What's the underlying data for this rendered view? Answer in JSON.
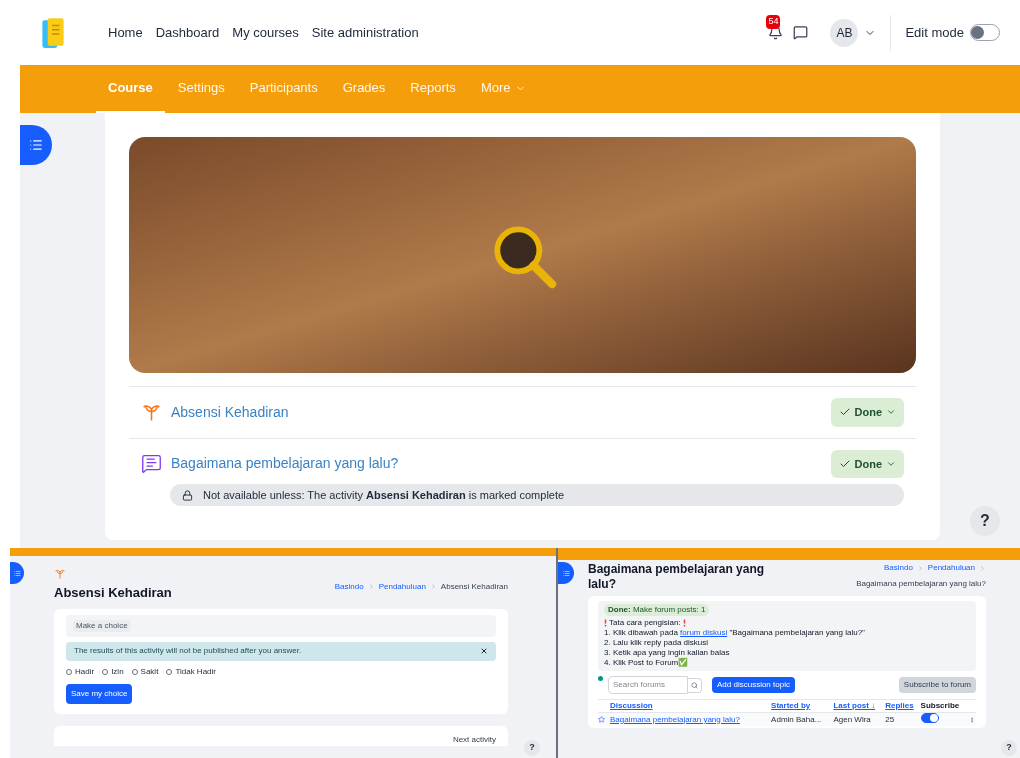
{
  "header": {
    "nav": [
      "Home",
      "Dashboard",
      "My courses",
      "Site administration"
    ],
    "notification_count": "54",
    "avatar": "AB",
    "edit_mode": {
      "label": "Edit mode",
      "on": false
    }
  },
  "tabs": [
    {
      "label": "Course",
      "selected": true
    },
    {
      "label": "Settings",
      "selected": false
    },
    {
      "label": "Participants",
      "selected": false
    },
    {
      "label": "Grades",
      "selected": false
    },
    {
      "label": "Reports",
      "selected": false
    },
    {
      "label": "More",
      "selected": false
    }
  ],
  "course": {
    "activities": [
      {
        "kind": "choice",
        "title": "Absensi Kehadiran",
        "status": "Done"
      },
      {
        "kind": "forum",
        "title": "Bagaimana pembelajaran yang lalu?",
        "status": "Done",
        "restriction": "Not available unless: The activity **Absensi Kehadiran** is marked complete"
      }
    ],
    "help": "?"
  },
  "choice_page": {
    "title": "Absensi Kehadiran",
    "breadcrumbs": [
      "Basindo",
      "Pendahuluan",
      "Absensi Kehadiran"
    ],
    "tag": "Make a choice",
    "notice": "The results of this activity will not be published after you answer.",
    "options": [
      {
        "label": "Hadir",
        "selected": false
      },
      {
        "label": "Izin",
        "selected": false
      },
      {
        "label": "Sakit",
        "selected": false
      },
      {
        "label": "Tidak Hadir",
        "selected": false
      }
    ],
    "button": "Save my choice",
    "next": "Next activity",
    "help": "?"
  },
  "forum_page": {
    "title": "Bagaimana pembelajaran yang lalu?",
    "breadcrumbs": [
      "Basindo",
      "Pendahuluan",
      "Bagaimana pembelajaran yang lalu?"
    ],
    "completion": "**Done:** Make forum posts: 1",
    "heading": "Tata cara pengisian:",
    "instructions": [
      {
        "text": "1. Klik dibawah pada ",
        "link": "forum diskusi",
        "after": " \"Bagaimana pembelajaran yang lalu?\""
      },
      {
        "text": "2. Lalu klik reply pada diskusi"
      },
      {
        "text": "3. Ketik apa yang ingin kalian balas"
      },
      {
        "text": "4. Klik Post to Forum✅"
      }
    ],
    "search_placeholder": "Search forums",
    "add_button": "Add discussion topic",
    "subscribe_button": "Subscribe to forum",
    "columns": [
      "Discussion",
      "Started by",
      "Last post ↓",
      "Replies",
      "Subscribe"
    ],
    "rows": [
      {
        "discussion": "Bagaimana pembelajaran yang lalu?",
        "started_by": "Admin Baha...",
        "last_post": "Agen Wira",
        "replies": "25",
        "subscribed": true
      }
    ],
    "help": "?"
  }
}
